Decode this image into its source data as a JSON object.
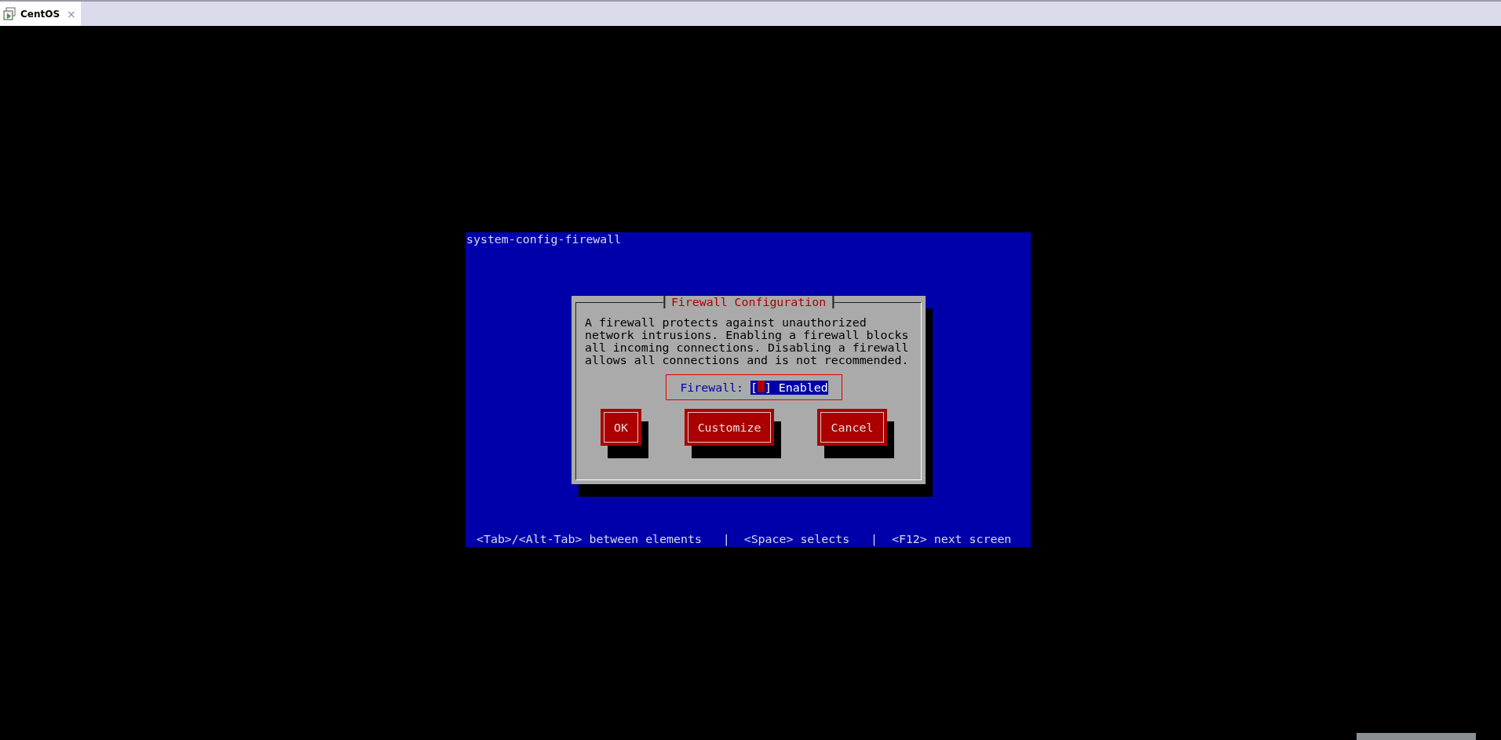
{
  "tab": {
    "title": "CentOS",
    "close": "×",
    "selected": true
  },
  "screen": {
    "title": "system-config-firewall",
    "footer": "<Tab>/<Alt-Tab> between elements   |  <Space> selects   |  <F12> next screen"
  },
  "dialog": {
    "title": "Firewall Configuration",
    "message": "A firewall protects against unauthorized network intrusions. Enabling a firewall blocks all incoming connections. Disabling a firewall allows all connections and is not recommended.",
    "field": {
      "label": "Firewall:",
      "open": "[",
      "close": "]",
      "checked": false,
      "focused": true,
      "option": "Enabled"
    },
    "buttons": [
      {
        "label": "OK"
      },
      {
        "label": "Customize"
      },
      {
        "label": "Cancel"
      }
    ]
  }
}
